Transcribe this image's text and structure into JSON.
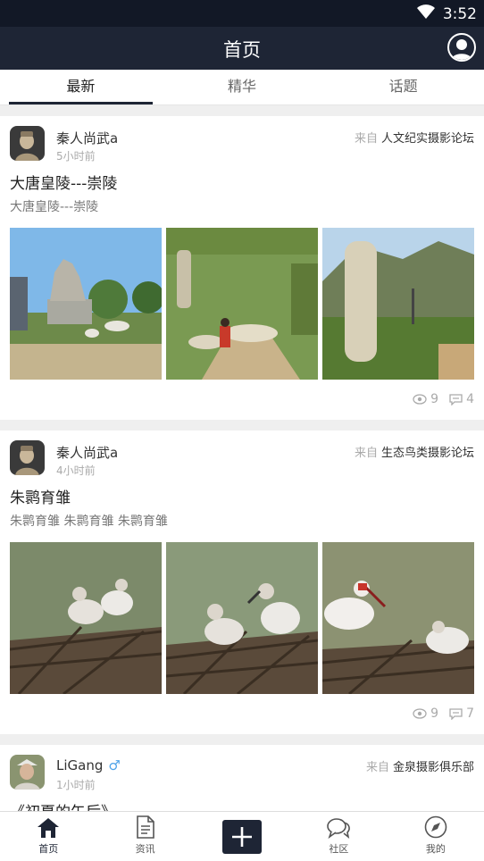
{
  "status_bar": {
    "time": "3:52"
  },
  "header": {
    "title": "首页"
  },
  "tabs": [
    {
      "label": "最新",
      "active": true
    },
    {
      "label": "精华",
      "active": false
    },
    {
      "label": "话题",
      "active": false
    }
  ],
  "posts": [
    {
      "user": "秦人尚武a",
      "time": "5小时前",
      "source_prefix": "来自",
      "source": "人文纪实摄影论坛",
      "title": "大唐皇陵---崇陵",
      "summary": "大唐皇陵---崇陵",
      "views": "9",
      "comments": "4"
    },
    {
      "user": "秦人尚武a",
      "time": "4小时前",
      "source_prefix": "来自",
      "source": "生态鸟类摄影论坛",
      "title": "朱鹮育雏",
      "summary": "朱鹮育雏 朱鹮育雏 朱鹮育雏",
      "views": "9",
      "comments": "7"
    },
    {
      "user": "LiGang",
      "gender": "♂",
      "time": "1小时前",
      "source_prefix": "来自",
      "source": "金泉摄影俱乐部",
      "title": "《初夏的午后》"
    }
  ],
  "bottom_nav": [
    {
      "label": "首页",
      "icon": "home-icon",
      "active": true
    },
    {
      "label": "资讯",
      "icon": "document-icon",
      "active": false
    },
    {
      "label": "",
      "icon": "plus-icon",
      "active": false
    },
    {
      "label": "社区",
      "icon": "chat-bubbles-icon",
      "active": false
    },
    {
      "label": "我的",
      "icon": "compass-icon",
      "active": false
    }
  ],
  "colors": {
    "header": "#1e2535",
    "status_bar": "#121826",
    "accent": "#1e2535"
  }
}
